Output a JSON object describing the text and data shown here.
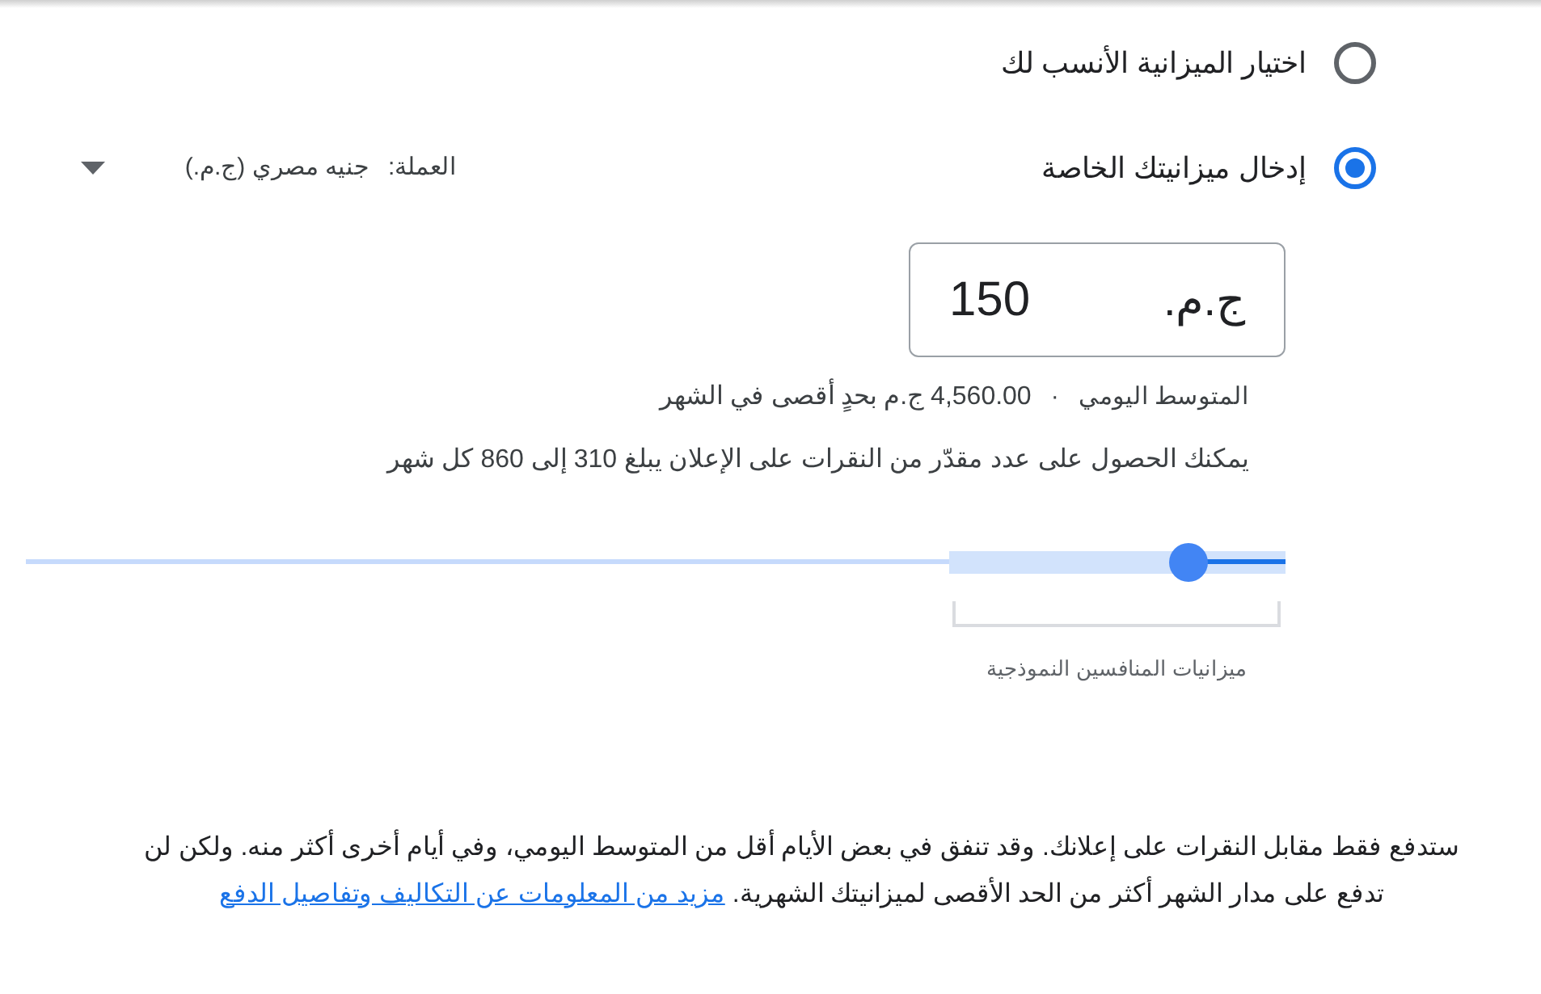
{
  "budget_options": [
    {
      "label": "اختيار الميزانية الأنسب لك",
      "selected": false
    },
    {
      "label": "إدخال ميزانيتك الخاصة",
      "selected": true
    }
  ],
  "currency": {
    "label": "العملة:",
    "value": "جنيه مصري (ج.م.)"
  },
  "budget_field": {
    "currency_symbol": "ج.م.",
    "value": "150"
  },
  "daily_average": {
    "label": "المتوسط اليومي",
    "separator": "·",
    "amount": "4,560.00",
    "suffix": "ج.م بحدٍ أقصى في الشهر"
  },
  "clicks_estimate": "يمكنك الحصول على عدد مقدّر من النقرات على الإعلان يبلغ 310 إلى 860 كل شهر",
  "slider": {
    "level": 0.077,
    "range_label": "ميزانيات المنافسين النموذجية"
  },
  "footnote": {
    "text": "ستدفع فقط مقابل النقرات على إعلانك. وقد تنفق في بعض الأيام أقل من المتوسط اليومي، وفي أيام أخرى أكثر منه. ولكن لن تدفع على مدار الشهر أكثر من الحد الأقصى لميزانيتك الشهرية.",
    "link": "مزيد من المعلومات عن التكاليف وتفاصيل الدفع"
  }
}
